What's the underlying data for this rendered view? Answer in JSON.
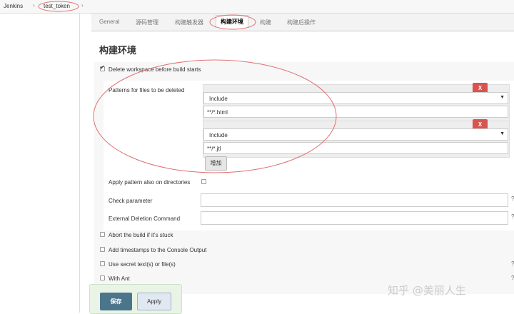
{
  "breadcrumb": {
    "root": "Jenkins",
    "sep1": "›",
    "job": "test_token",
    "sep2": "›"
  },
  "tabs": [
    {
      "label": "General"
    },
    {
      "label": "源码管理"
    },
    {
      "label": "构建触发器"
    },
    {
      "label": "构建环境"
    },
    {
      "label": "构建"
    },
    {
      "label": "构建后操作"
    }
  ],
  "section_title": "构建环境",
  "delete_workspace": {
    "label": "Delete workspace before build starts",
    "checked": true
  },
  "patterns": {
    "label": "Patterns for files to be deleted",
    "rows": [
      {
        "type": "Include",
        "value": "**/*.html",
        "delete_label": "X"
      },
      {
        "type": "Include",
        "value": "**/*.jtl",
        "delete_label": "X"
      }
    ],
    "add_label": "增加"
  },
  "apply_dirs": {
    "label": "Apply pattern also on directories"
  },
  "check_parameter": {
    "label": "Check parameter",
    "value": ""
  },
  "external_deletion": {
    "label": "External Deletion Command",
    "value": ""
  },
  "options": [
    {
      "label": "Abort the build if it's stuck"
    },
    {
      "label": "Add timestamps to the Console Output"
    },
    {
      "label": "Use secret text(s) or file(s)"
    },
    {
      "label": "With Ant"
    }
  ],
  "buttons": {
    "save": "保存",
    "apply": "Apply"
  },
  "watermark": "知乎 @美丽人生",
  "colors": {
    "delete_button": "#d9534f",
    "save_button": "#4b758b",
    "annotation_ellipse": "#e07070"
  }
}
